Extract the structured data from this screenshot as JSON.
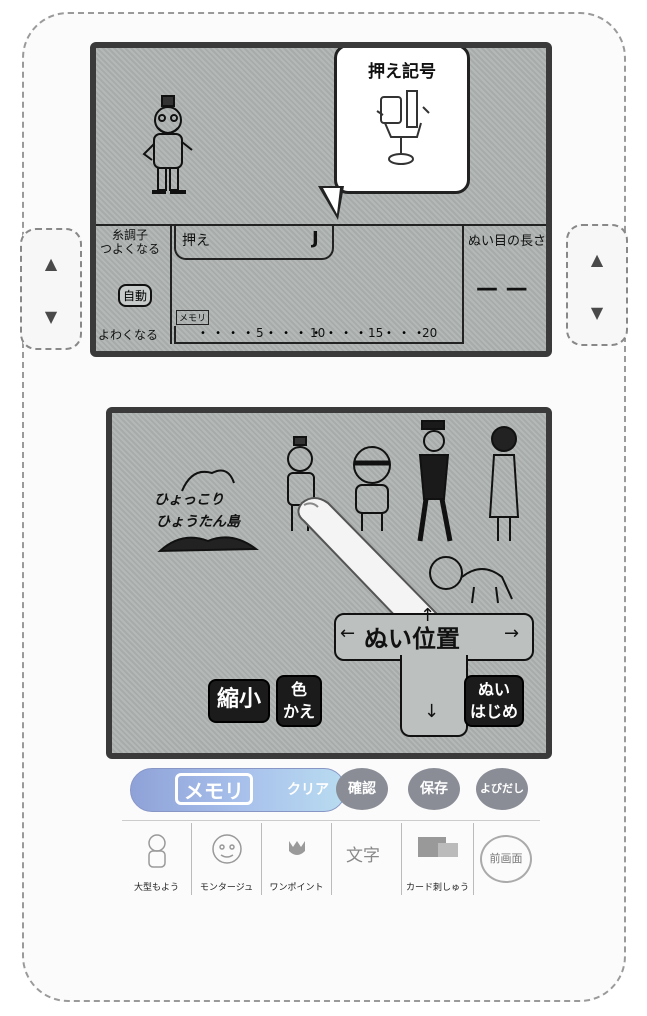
{
  "top_screen": {
    "callout_title": "押え記号",
    "tension_label_line1": "糸調子",
    "tension_label_line2": "つよくなる",
    "auto_button": "自動",
    "weaker_label": "よわくなる",
    "foot_name": "押え",
    "foot_letter": "J",
    "memory_tag": "メモリ",
    "scale": [
      "5",
      "10",
      "15",
      "20"
    ],
    "stitch_length_label": "ぬい目の長さ",
    "stitch_length_value": "— —"
  },
  "bottom_screen": {
    "island_text_line1": "ひょっこり",
    "island_text_line2": "ひょうたん島",
    "shrink_button": "縮小",
    "color_change_line1": "色",
    "color_change_line2": "かえ",
    "sew_position_label": "ぬい位置",
    "sew_start_line1": "ぬい",
    "sew_start_line2": "はじめ"
  },
  "panel": {
    "memory_button": "メモリ",
    "clear_button": "クリア",
    "confirm_button": "確認",
    "save_button": "保存",
    "recall_button": "よびだし",
    "pattern_buttons": [
      "大型もよう",
      "モンタージュ",
      "ワンポイント",
      "文字",
      "カード刺しゅう"
    ],
    "previous_screen_button": "前画面"
  },
  "colors": {
    "lcd": "#aeb3b2",
    "memory_pill": "#a9c2ec",
    "round_buttons": "#8a8d96"
  }
}
